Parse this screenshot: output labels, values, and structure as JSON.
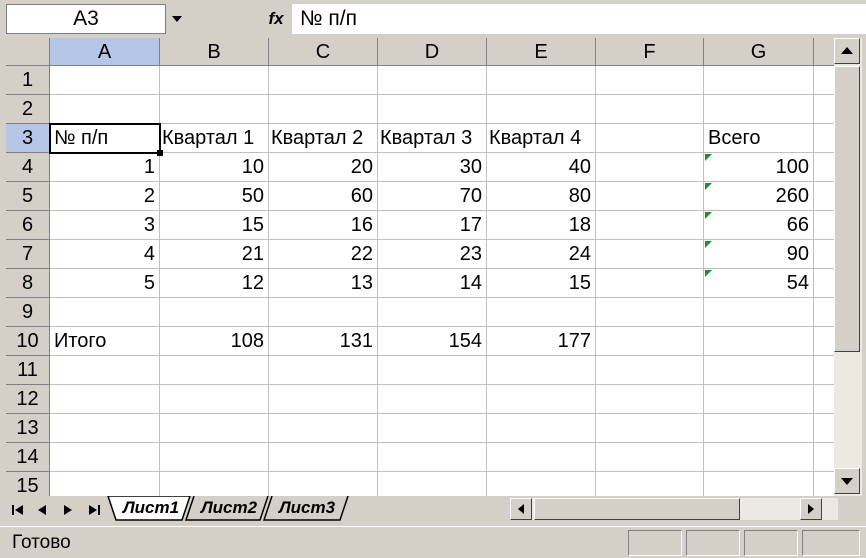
{
  "formula_bar": {
    "name_box": "A3",
    "fx_label": "fx",
    "formula": "№ п/п"
  },
  "columns": [
    "A",
    "B",
    "C",
    "D",
    "E",
    "F",
    "G"
  ],
  "rows": [
    "1",
    "2",
    "3",
    "4",
    "5",
    "6",
    "7",
    "8",
    "9",
    "10",
    "11",
    "12",
    "13",
    "14",
    "15"
  ],
  "active_cell": "A3",
  "cells": {
    "r3": {
      "a": "№ п/п",
      "b": "Квартал 1",
      "c": "Квартал 2",
      "d": "Квартал 3",
      "e": "Квартал 4",
      "g": "Всего"
    },
    "r4": {
      "a": "1",
      "b": "10",
      "c": "20",
      "d": "30",
      "e": "40",
      "g": "100"
    },
    "r5": {
      "a": "2",
      "b": "50",
      "c": "60",
      "d": "70",
      "e": "80",
      "g": "260"
    },
    "r6": {
      "a": "3",
      "b": "15",
      "c": "16",
      "d": "17",
      "e": "18",
      "g": "66"
    },
    "r7": {
      "a": "4",
      "b": "21",
      "c": "22",
      "d": "23",
      "e": "24",
      "g": "90"
    },
    "r8": {
      "a": "5",
      "b": "12",
      "c": "13",
      "d": "14",
      "e": "15",
      "g": "54"
    },
    "r10": {
      "a": "Итого",
      "b": "108",
      "c": "131",
      "d": "154",
      "e": "177"
    }
  },
  "sheet_tabs": [
    "Лист1",
    "Лист2",
    "Лист3"
  ],
  "active_sheet": "Лист1",
  "status": "Готово",
  "colors": {
    "header_bg": "#d4d0c8",
    "active_header": "#b6c6e6",
    "error_indicator": "#1f8f2f",
    "gridline": "#c0c0c0"
  }
}
